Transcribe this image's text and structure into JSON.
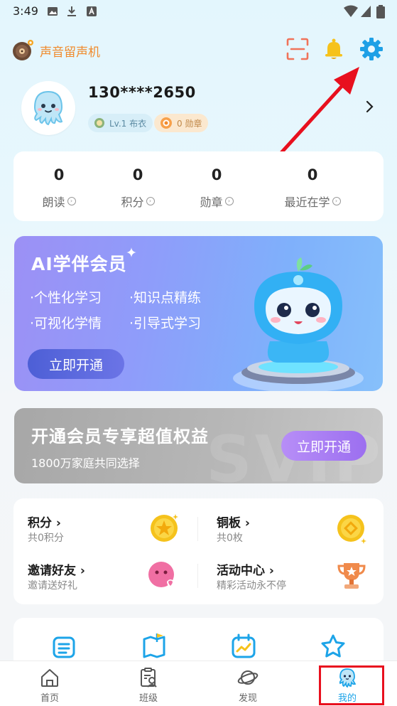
{
  "status_bar": {
    "time": "3:49"
  },
  "header": {
    "app_name": "声音留声机"
  },
  "profile": {
    "phone": "130****2650",
    "level_badge": "Lv.1 布衣",
    "medal_badge": "0 勋章"
  },
  "stats": [
    {
      "value": "0",
      "label": "朗读"
    },
    {
      "value": "0",
      "label": "积分"
    },
    {
      "value": "0",
      "label": "勋章"
    },
    {
      "value": "0",
      "label": "最近在学"
    }
  ],
  "ai_banner": {
    "title": "AI学伴会员",
    "features": [
      "·个性化学习",
      "·知识点精练",
      "·可视化学情",
      "·引导式学习"
    ],
    "button": "立即开通"
  },
  "vip_banner": {
    "title": "开通会员专享超值权益",
    "subtitle": "1800万家庭共同选择",
    "button": "立即开通",
    "watermark": "SVIP"
  },
  "benefits": [
    {
      "title": "积分",
      "subtitle": "共0积分",
      "icon": "coin-star-icon"
    },
    {
      "title": "铜板",
      "subtitle": "共0枚",
      "icon": "copper-coin-icon"
    },
    {
      "title": "邀请好友",
      "subtitle": "邀请送好礼",
      "icon": "invite-face-icon"
    },
    {
      "title": "活动中心",
      "subtitle": "精彩活动永不停",
      "icon": "trophy-icon"
    }
  ],
  "bottom_nav": [
    {
      "label": "首页",
      "icon": "home-icon"
    },
    {
      "label": "班级",
      "icon": "class-icon"
    },
    {
      "label": "发现",
      "icon": "planet-icon"
    },
    {
      "label": "我的",
      "icon": "octopus-icon",
      "active": true
    }
  ],
  "colors": {
    "accent": "#1da4e8",
    "app_name": "#f08a2c",
    "annotation_red": "#e8101e"
  }
}
